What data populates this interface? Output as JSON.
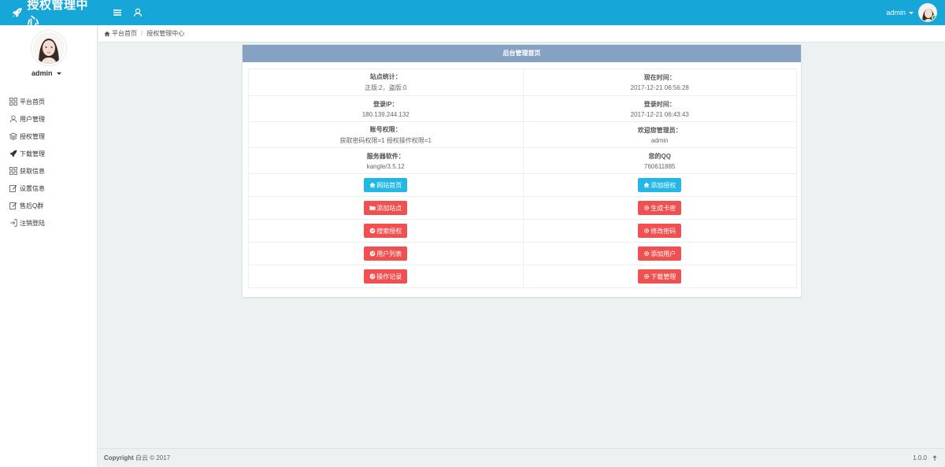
{
  "header": {
    "title": "授权管理中心",
    "username": "admin"
  },
  "sidebar": {
    "username": "admin",
    "items": [
      {
        "label": "平台首页",
        "icon": "grid-icon"
      },
      {
        "label": "用户管理",
        "icon": "user-icon"
      },
      {
        "label": "授权管理",
        "icon": "layers-icon"
      },
      {
        "label": "下载管理",
        "icon": "rocket-icon"
      },
      {
        "label": "获取信息",
        "icon": "grid-icon"
      },
      {
        "label": "设置信息",
        "icon": "edit-icon"
      },
      {
        "label": "售后Q群",
        "icon": "edit-icon"
      },
      {
        "label": "注销登陆",
        "icon": "logout-icon"
      }
    ]
  },
  "breadcrumb": {
    "home": "平台首页",
    "current": "授权管理中心"
  },
  "panel": {
    "title": "后台管理首页",
    "info": [
      [
        {
          "label": "站点统计：",
          "value": "正版:2，盗版:0"
        },
        {
          "label": "现在时间：",
          "value": "2017-12-21 06:56:28"
        }
      ],
      [
        {
          "label": "登录IP：",
          "value": "180.139.244.132"
        },
        {
          "label": "登录时间：",
          "value": "2017-12-21 06:43:43"
        }
      ],
      [
        {
          "label": "账号权限：",
          "value": "获取密码权限=1 授权操作权限=1"
        },
        {
          "label": "欢迎您管理员：",
          "value": "admin"
        }
      ],
      [
        {
          "label": "服务器软件：",
          "value": "kangle/3.5.12"
        },
        {
          "label": "您的QQ",
          "value": "760611885"
        }
      ]
    ],
    "buttons": [
      [
        {
          "label": "网站首页",
          "icon": "home-icon",
          "style": "info"
        },
        {
          "label": "添加授权",
          "icon": "home-icon",
          "style": "info"
        }
      ],
      [
        {
          "label": "添加站点",
          "icon": "folder-icon",
          "style": "danger"
        },
        {
          "label": "生成卡密",
          "icon": "gear-icon",
          "style": "danger"
        }
      ],
      [
        {
          "label": "搜索授权",
          "icon": "globe-icon",
          "style": "danger"
        },
        {
          "label": "修改密码",
          "icon": "gear-icon",
          "style": "danger"
        }
      ],
      [
        {
          "label": "用户列表",
          "icon": "globe-icon",
          "style": "danger"
        },
        {
          "label": "添加用户",
          "icon": "gear-icon",
          "style": "danger"
        }
      ],
      [
        {
          "label": "操作记录",
          "icon": "globe-icon",
          "style": "danger"
        },
        {
          "label": "下载管理",
          "icon": "gear-icon",
          "style": "danger"
        }
      ]
    ]
  },
  "footer": {
    "copyright_label": "Copyright",
    "copyright_text": "白云 © 2017",
    "version": "1.0.0"
  },
  "colors": {
    "header": "#16a7d8",
    "panel_head": "#86a2c2",
    "info": "#23b7e5",
    "danger": "#f05050"
  }
}
